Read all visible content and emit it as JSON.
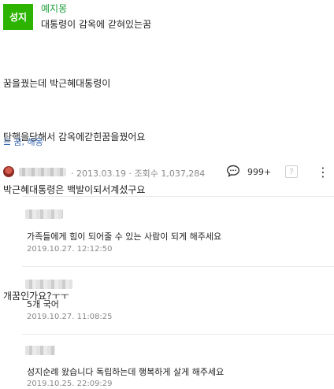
{
  "post": {
    "badge": "성지",
    "author": "예지몽",
    "title": "대통령이 감옥에 갇혀있는꿈",
    "body_lines": [
      "꿈을꿨는데 박근혜대통령이",
      "탄핵을당해서 감옥에갇힌꿈을꿨어요",
      "박근혜대통령은 백발이되서계셨구요",
      "",
      "개꿈인가요?ㅜㅜ"
    ],
    "tags": "☰ 꿈, 해몽"
  },
  "meta": {
    "info": "· 2013.03.19 · 조회수 1,037,284",
    "comment_count": "999+",
    "qa_icon_label": "?"
  },
  "comments": [
    {
      "text": "가족들에게 힘이 되어줄 수 있는 사람이 되게 해주세요",
      "date": "2019.10.27. 12:12:50"
    },
    {
      "text": "5개 국어",
      "date": "2019.10.27. 11:08:25"
    },
    {
      "text": "성지순례 왔습니다 독립하는데 행복하게 살게 해주세요",
      "date": "2019.10.25. 22:09:29"
    }
  ],
  "colors": {
    "badge": "#2db400",
    "author": "#1b9d3a",
    "tags": "#3a6bb5"
  }
}
